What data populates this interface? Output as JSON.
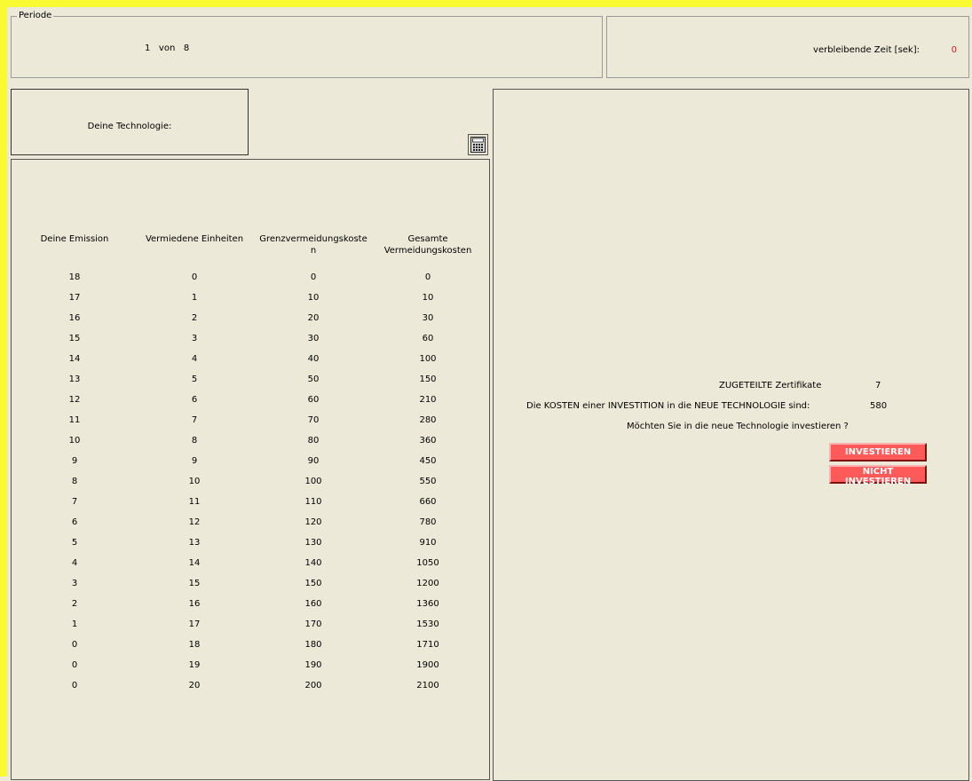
{
  "period": {
    "legend": "Periode",
    "current": "1",
    "separator": "von",
    "total": "8"
  },
  "timer": {
    "label": "verbleibende Zeit [sek]:",
    "value": "0",
    "value_color": "#d02020"
  },
  "technology": {
    "label": "Deine Technologie:"
  },
  "calculator": {
    "icon": "calculator-icon"
  },
  "table": {
    "headers": [
      [
        "Deine Emission"
      ],
      [
        "Vermiedene Einheiten"
      ],
      [
        "Grenzvermeidungskoste",
        "n"
      ],
      [
        "Gesamte",
        "Vermeidungskosten"
      ]
    ],
    "rows": [
      [
        "18",
        "0",
        "0",
        "0"
      ],
      [
        "17",
        "1",
        "10",
        "10"
      ],
      [
        "16",
        "2",
        "20",
        "30"
      ],
      [
        "15",
        "3",
        "30",
        "60"
      ],
      [
        "14",
        "4",
        "40",
        "100"
      ],
      [
        "13",
        "5",
        "50",
        "150"
      ],
      [
        "12",
        "6",
        "60",
        "210"
      ],
      [
        "11",
        "7",
        "70",
        "280"
      ],
      [
        "10",
        "8",
        "80",
        "360"
      ],
      [
        "9",
        "9",
        "90",
        "450"
      ],
      [
        "8",
        "10",
        "100",
        "550"
      ],
      [
        "7",
        "11",
        "110",
        "660"
      ],
      [
        "6",
        "12",
        "120",
        "780"
      ],
      [
        "5",
        "13",
        "130",
        "910"
      ],
      [
        "4",
        "14",
        "140",
        "1050"
      ],
      [
        "3",
        "15",
        "150",
        "1200"
      ],
      [
        "2",
        "16",
        "160",
        "1360"
      ],
      [
        "1",
        "17",
        "170",
        "1530"
      ],
      [
        "0",
        "18",
        "180",
        "1710"
      ],
      [
        "0",
        "19",
        "190",
        "1900"
      ],
      [
        "0",
        "20",
        "200",
        "2100"
      ]
    ]
  },
  "investment": {
    "certificates_label": "ZUGETEILTE Zertifikate",
    "certificates_value": "7",
    "cost_label": "Die KOSTEN einer INVESTITION in die NEUE TECHNOLOGIE sind:",
    "cost_value": "580",
    "question": "Möchten Sie in die neue Technologie investieren ?",
    "invest_button": "INVESTIEREN",
    "no_invest_button": "NICHT INVESTIEREN",
    "button_color": "#ff5a5a"
  }
}
